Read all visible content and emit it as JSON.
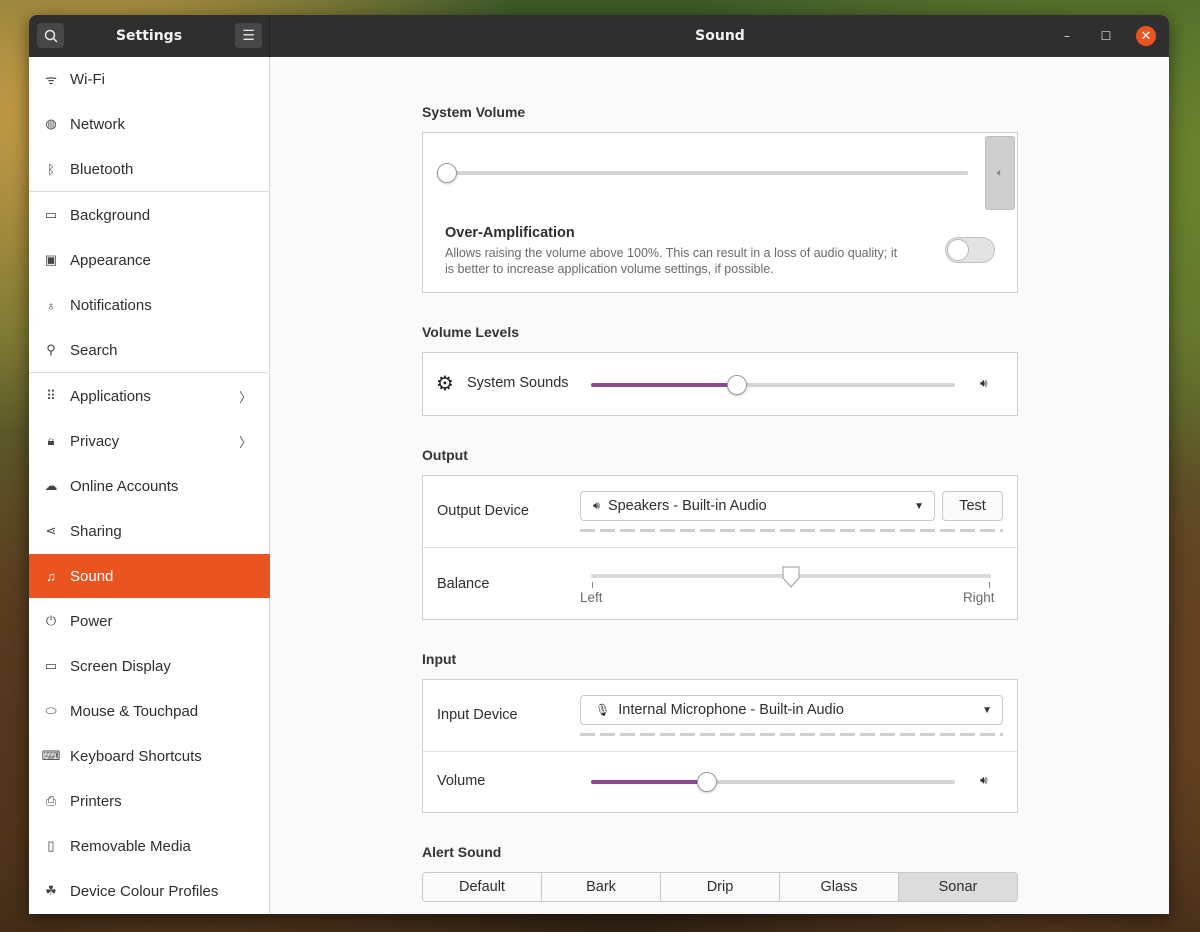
{
  "window": {
    "sidebar_title": "Settings",
    "page_title": "Sound"
  },
  "sidebar": {
    "items": [
      {
        "label": "Wi-Fi",
        "icon": "wifi-icon"
      },
      {
        "label": "Network",
        "icon": "network-icon"
      },
      {
        "label": "Bluetooth",
        "icon": "bluetooth-icon"
      },
      {
        "label": "Background",
        "icon": "background-icon"
      },
      {
        "label": "Appearance",
        "icon": "appearance-icon"
      },
      {
        "label": "Notifications",
        "icon": "bell-icon"
      },
      {
        "label": "Search",
        "icon": "search-icon"
      },
      {
        "label": "Applications",
        "icon": "grid-icon"
      },
      {
        "label": "Privacy",
        "icon": "lock-icon"
      },
      {
        "label": "Online Accounts",
        "icon": "cloud-icon"
      },
      {
        "label": "Sharing",
        "icon": "share-icon"
      },
      {
        "label": "Sound",
        "icon": "music-note-icon"
      },
      {
        "label": "Power",
        "icon": "power-icon"
      },
      {
        "label": "Screen Display",
        "icon": "display-icon"
      },
      {
        "label": "Mouse & Touchpad",
        "icon": "mouse-icon"
      },
      {
        "label": "Keyboard Shortcuts",
        "icon": "keyboard-icon"
      },
      {
        "label": "Printers",
        "icon": "printer-icon"
      },
      {
        "label": "Removable Media",
        "icon": "removable-media-icon"
      },
      {
        "label": "Device Colour Profiles",
        "icon": "colour-profiles-icon"
      }
    ],
    "active": "Sound"
  },
  "system_volume": {
    "title": "System Volume",
    "level": 0,
    "over_amplification_title": "Over-Amplification",
    "over_amplification_desc_line1": "Allows raising the volume above 100%. This can result in a loss of audio quality; it",
    "over_amplification_desc_line2": "is better to increase application volume settings, if possible.",
    "over_amplification_enabled": false
  },
  "volume_levels": {
    "title": "Volume Levels",
    "system_sounds_label": "System Sounds",
    "system_sounds_level": 0.4
  },
  "output": {
    "title": "Output",
    "device_label": "Output Device",
    "device_value": "Speakers - Built-in Audio",
    "test_label": "Test",
    "balance_label": "Balance",
    "balance_left": "Left",
    "balance_right": "Right",
    "balance_value": 0.5
  },
  "input": {
    "title": "Input",
    "device_label": "Input Device",
    "device_value": "Internal Microphone - Built-in Audio",
    "volume_label": "Volume",
    "volume_level": 0.32
  },
  "alert_sound": {
    "title": "Alert Sound",
    "options": [
      "Default",
      "Bark",
      "Drip",
      "Glass",
      "Sonar"
    ],
    "selected": "Sonar"
  },
  "colors": {
    "accent": "#e95420",
    "slider_fill": "#8c4b8f"
  }
}
